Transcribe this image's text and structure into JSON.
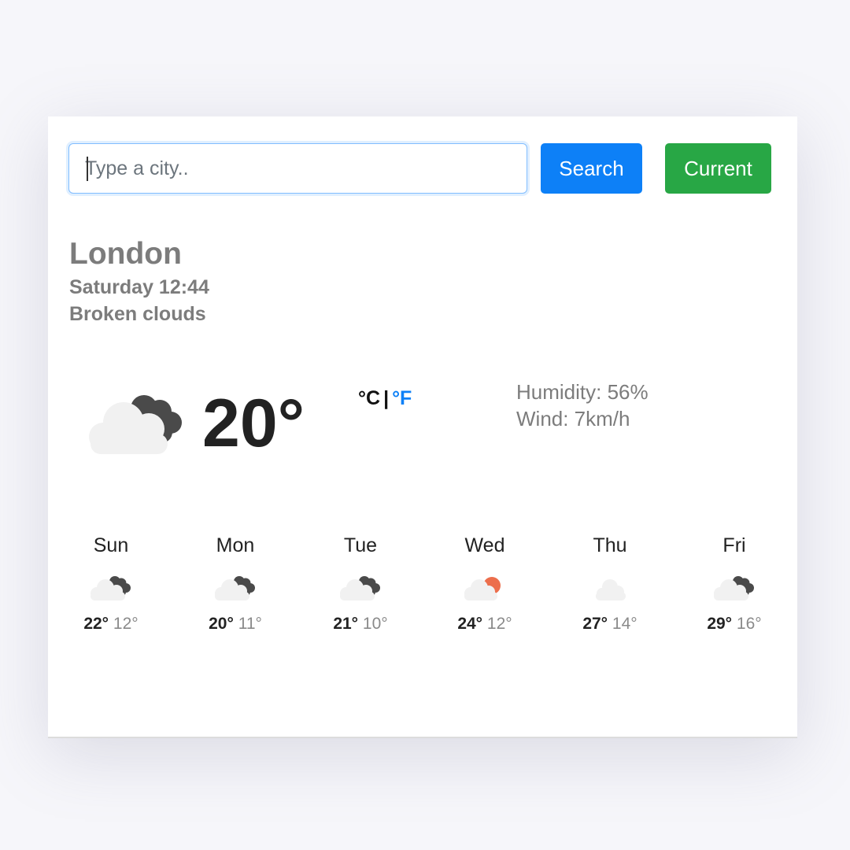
{
  "search": {
    "placeholder": "Type a city..",
    "search_label": "Search",
    "current_label": "Current"
  },
  "location": {
    "city": "London",
    "datetime": "Saturday 12:44",
    "description": "Broken clouds"
  },
  "current": {
    "icon": "broken-clouds-icon",
    "temperature": "20°",
    "unit_c": "°C",
    "unit_sep": "|",
    "unit_f": "°F",
    "humidity": "Humidity: 56%",
    "wind": "Wind: 7km/h"
  },
  "forecast": [
    {
      "day": "Sun",
      "icon": "broken-clouds-icon",
      "max": "22°",
      "min": "12°"
    },
    {
      "day": "Mon",
      "icon": "broken-clouds-icon",
      "max": "20°",
      "min": "11°"
    },
    {
      "day": "Tue",
      "icon": "broken-clouds-icon",
      "max": "21°",
      "min": "10°"
    },
    {
      "day": "Wed",
      "icon": "partly-sunny-icon",
      "max": "24°",
      "min": "12°"
    },
    {
      "day": "Thu",
      "icon": "cloud-icon",
      "max": "27°",
      "min": "14°"
    },
    {
      "day": "Fri",
      "icon": "broken-clouds-icon",
      "max": "29°",
      "min": "16°"
    }
  ],
  "colors": {
    "primary": "#0d80f7",
    "success": "#28a745",
    "sun": "#ec6e4c",
    "dark_cloud": "#4a4a4a",
    "light_cloud": "#f1f1f1"
  }
}
